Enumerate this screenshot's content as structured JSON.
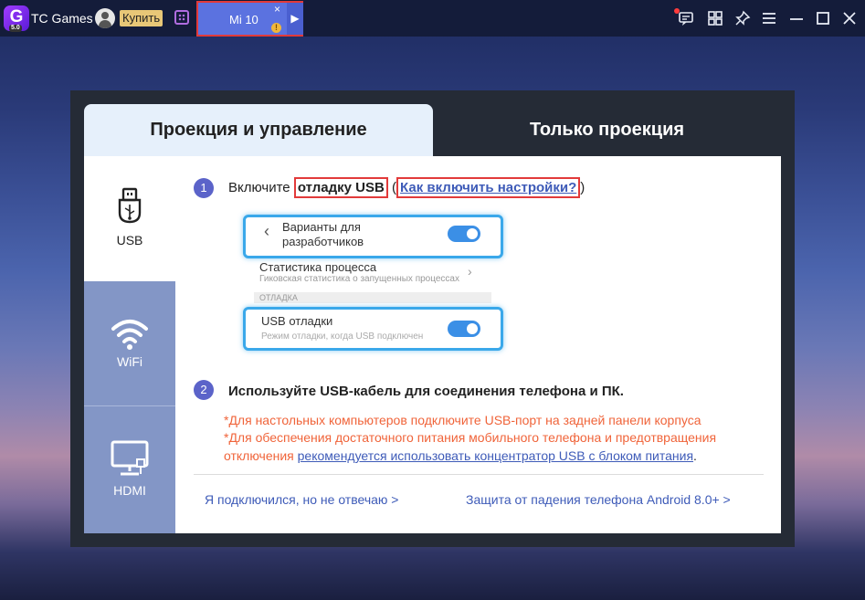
{
  "topbar": {
    "logo_text": "G",
    "logo_badge": "5.0",
    "app_title": "TC Games",
    "buy_label": "Купить",
    "device_tab": {
      "name": "Mi 10",
      "close": "×",
      "warn": "!",
      "arrow": "▶"
    },
    "controls": {
      "chat": "💬",
      "grid": "⊞",
      "pin": "📌",
      "menu": "≡",
      "minimize": "—",
      "maximize": "☐",
      "close": "✕"
    }
  },
  "dialog": {
    "tabs": [
      {
        "label": "Проекция и управление",
        "active": true
      },
      {
        "label": "Только проекция",
        "active": false
      }
    ],
    "sidebar": [
      {
        "label": "USB",
        "icon": "usb-icon",
        "active": true
      },
      {
        "label": "WiFi",
        "icon": "wifi-icon",
        "active": false
      },
      {
        "label": "HDMI",
        "icon": "hdmi-icon",
        "active": false
      }
    ],
    "step1": {
      "number": "1",
      "prefix": "Включите ",
      "highlight": "отладку USB",
      "open_paren": " (",
      "link": "Как включить настройки?",
      "close_paren": ")"
    },
    "phone_preview": {
      "dev_options": "Варианты для разработчиков",
      "stats_title": "Статистика процесса",
      "stats_sub": "Гиковская статистика о запущенных процессах",
      "section": "ОТЛАДКА",
      "usb_debug_title": "USB отладки",
      "usb_debug_sub": "Режим отладки, когда USB подключен"
    },
    "step2": {
      "number": "2",
      "text": "Используйте USB-кабель для соединения телефона и ПК."
    },
    "notes": {
      "line1": "*Для настольных компьютеров подключите USB-порт на задней панели корпуса",
      "line2": "*Для обеспечения достаточного питания мобильного телефона и предотвращения",
      "line3_prefix": "отключения ",
      "line3_link": "рекомендуется использовать концентратор USB с блоком питания",
      "line3_suffix": "."
    },
    "footer": {
      "left_link": "Я подключился, но не отвечаю >",
      "right_link": "Защита от падения телефона Android 8.0+ >"
    }
  },
  "colors": {
    "accent": "#5b63c9",
    "link": "#3e5bb8",
    "warning": "#f0643a",
    "highlight_border": "#e23a3a",
    "toggle": "#3b8fe6",
    "sidebar": "#8396c6"
  }
}
